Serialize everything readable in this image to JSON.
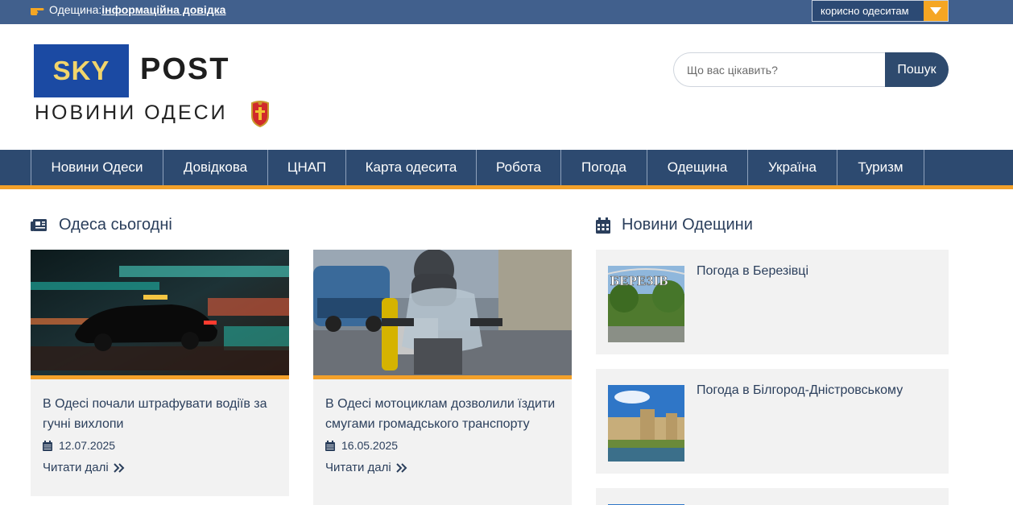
{
  "topbar": {
    "region_label": "Одещина:",
    "region_link": "інформаційна довідка",
    "useful_label": "корисно одеситам"
  },
  "logo": {
    "sky": "SKY",
    "post": "POST",
    "subtitle": "НОВИНИ ОДЕСИ"
  },
  "search": {
    "placeholder": "Що вас цікавить?",
    "button": "Пошук"
  },
  "nav": {
    "items": [
      {
        "label": "Новини Одеси"
      },
      {
        "label": "Довідкова"
      },
      {
        "label": "ЦНАП"
      },
      {
        "label": "Карта одесита"
      },
      {
        "label": "Робота"
      },
      {
        "label": "Погода"
      },
      {
        "label": "Одещина"
      },
      {
        "label": "Україна"
      },
      {
        "label": "Туризм"
      }
    ]
  },
  "today": {
    "heading": "Одеса сьогодні",
    "articles": [
      {
        "title": "В Одесі почали штрафувати водіїв за гучні вихлопи",
        "date": "12.07.2025",
        "more": "Читати далі"
      },
      {
        "title": "В Одесі мотоциклам дозволили їздити смугами громадського транспорту",
        "date": "16.05.2025",
        "more": "Читати далі"
      }
    ]
  },
  "region": {
    "heading": "Новини Одещини",
    "items": [
      {
        "title": "Погода в Березівці",
        "thumb_text": "БЕРЕЗІВ"
      },
      {
        "title": "Погода в Білгород-Дністровському"
      }
    ]
  },
  "colors": {
    "topbar": "#41608d",
    "nav": "#2d4a70",
    "accent": "#f3a12a",
    "text": "#2b3f5c"
  }
}
